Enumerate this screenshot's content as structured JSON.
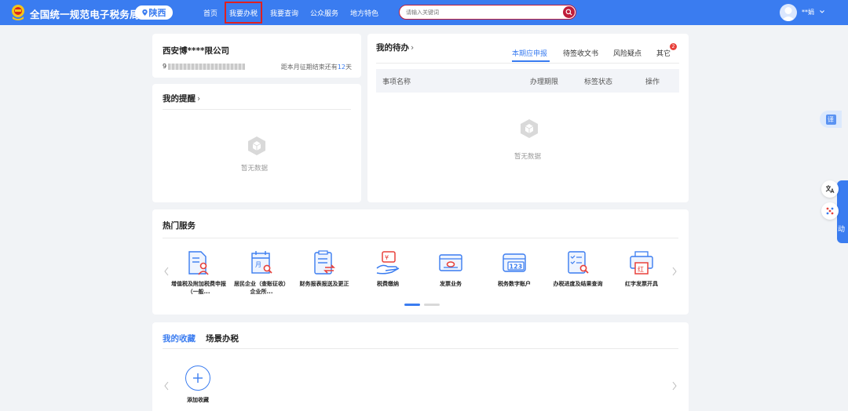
{
  "header": {
    "title": "全国统一规范电子税务局",
    "region": "陕西",
    "nav": [
      "首页",
      "我要办税",
      "我要查询",
      "公众服务",
      "地方特色"
    ],
    "search_placeholder": "请输入关键词",
    "user": "**娟",
    "colors": {
      "bar": "#3a7cf0",
      "highlight_border": "#e02020",
      "search_accent": "#c01d3a"
    }
  },
  "company": {
    "name": "西安博****限公司",
    "tax_id_prefix": "9",
    "deadline_prefix": "距本月征期结束还有",
    "deadline_days": "12",
    "deadline_suffix": "天"
  },
  "reminders": {
    "title": "我的提醒",
    "empty": "暂无数据"
  },
  "todo": {
    "title": "我的待办",
    "tabs": [
      "本期应申报",
      "待签收文书",
      "风险疑点",
      "其它"
    ],
    "active_tab": 0,
    "other_badge": "2",
    "columns": [
      "事项名称",
      "办理期限",
      "标签状态",
      "操作"
    ],
    "empty": "暂无数据"
  },
  "hot_services": {
    "title": "热门服务",
    "items": [
      {
        "label": "增值税及附加税费申报（一般...",
        "icon": "document-person-icon"
      },
      {
        "label": "居民企业（查账征收）企业所...",
        "icon": "calendar-search-icon"
      },
      {
        "label": "财务报表报送及更正",
        "icon": "document-exchange-icon"
      },
      {
        "label": "税费缴纳",
        "icon": "hand-coin-icon"
      },
      {
        "label": "发票业务",
        "icon": "invoice-icon"
      },
      {
        "label": "税务数字账户",
        "icon": "account-123-icon"
      },
      {
        "label": "办税进度及结果查询",
        "icon": "checklist-search-icon"
      },
      {
        "label": "红字发票开具",
        "icon": "red-invoice-printer-icon"
      }
    ],
    "page_count": 2,
    "current_page": 0
  },
  "favorites": {
    "tabs": [
      "我的收藏",
      "场景办税"
    ],
    "add_label": "添加收藏"
  },
  "side_float": {
    "translate": "译",
    "more": "动"
  }
}
